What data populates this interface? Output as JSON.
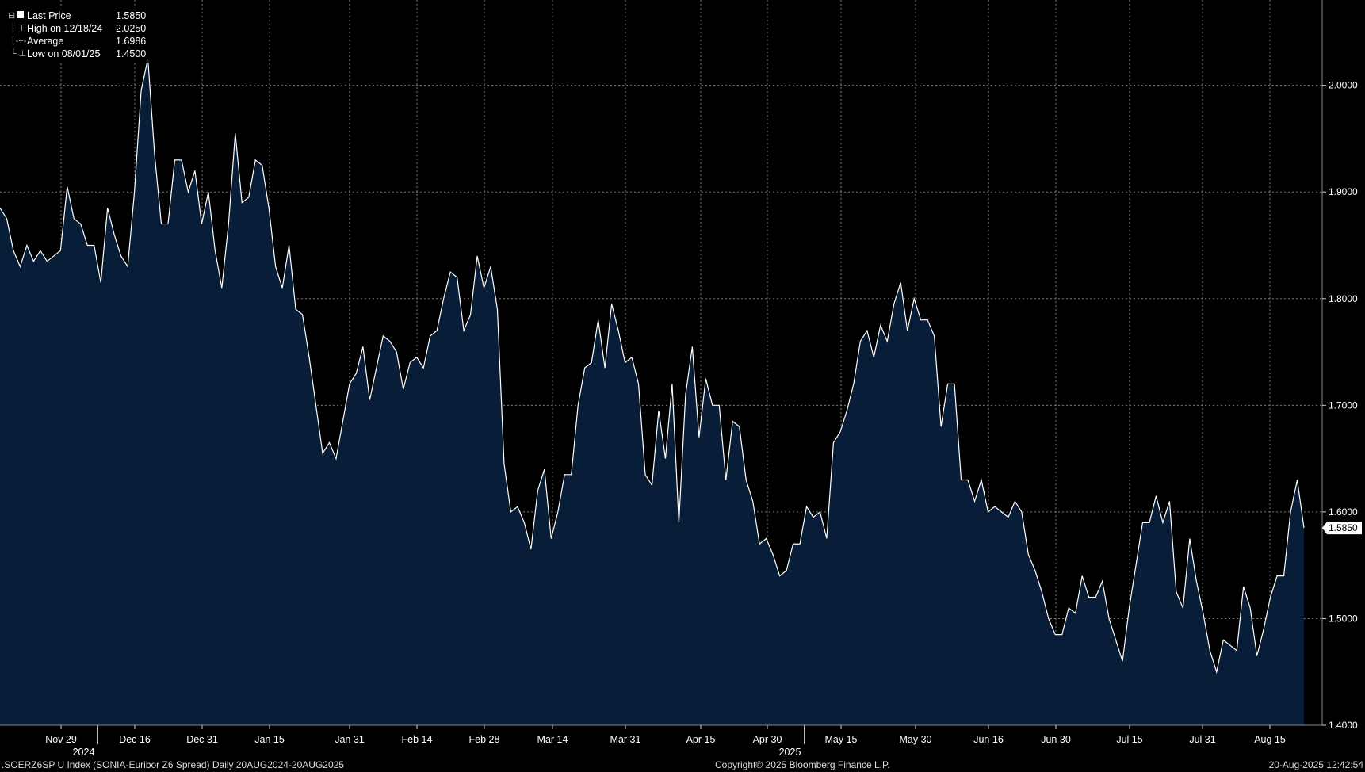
{
  "legend": {
    "items": [
      {
        "label": "Last Price",
        "value": "1.5850"
      },
      {
        "label": "High on 12/18/24",
        "value": "2.0250"
      },
      {
        "label": "Average",
        "value": "1.6986"
      },
      {
        "label": "Low on 08/01/25",
        "value": "1.4500"
      }
    ]
  },
  "footer": {
    "left": ".SOERZ6SP U Index (SONIA-Euribor Z6 Spread)  Daily 20AUG2024-20AUG2025",
    "center": "Copyright© 2025 Bloomberg Finance L.P.",
    "right": "20-Aug-2025 12:42:54"
  },
  "colors": {
    "background": "#000000",
    "area": "#081d38",
    "line": "#ffffff",
    "grid": "#7a7a7a",
    "last_label_bg": "#ffffff"
  },
  "chart_data": {
    "type": "area",
    "ylim": [
      1.4,
      2.08
    ],
    "y_ticks": [
      "1.4000",
      "1.5000",
      "1.6000",
      "1.7000",
      "1.8000",
      "1.9000",
      "2.0000"
    ],
    "x_ticks": [
      "Nov 29",
      "Dec 16",
      "Dec 31",
      "Jan 15",
      "Jan 31",
      "Feb 14",
      "Feb 28",
      "Mar 14",
      "Mar 31",
      "Apr 15",
      "Apr 30",
      "May 15",
      "May 30",
      "Jun 16",
      "Jun 30",
      "Jul 15",
      "Jul 31",
      "Aug 15"
    ],
    "year_labels": [
      {
        "label": "2024",
        "after_tick": "Nov 29"
      },
      {
        "label": "2025",
        "after_tick": "Apr 30"
      }
    ],
    "last_value_label": "1.5850",
    "values": [
      1.885,
      1.875,
      1.845,
      1.83,
      1.85,
      1.835,
      1.845,
      1.835,
      1.84,
      1.845,
      1.905,
      1.875,
      1.87,
      1.85,
      1.85,
      1.815,
      1.885,
      1.86,
      1.84,
      1.83,
      1.9,
      1.995,
      2.025,
      1.935,
      1.87,
      1.87,
      1.93,
      1.93,
      1.9,
      1.92,
      1.87,
      1.9,
      1.845,
      1.81,
      1.87,
      1.955,
      1.89,
      1.895,
      1.93,
      1.925,
      1.885,
      1.83,
      1.81,
      1.85,
      1.79,
      1.785,
      1.745,
      1.7,
      1.655,
      1.665,
      1.65,
      1.685,
      1.72,
      1.73,
      1.755,
      1.705,
      1.735,
      1.765,
      1.76,
      1.75,
      1.715,
      1.74,
      1.745,
      1.735,
      1.765,
      1.77,
      1.8,
      1.825,
      1.82,
      1.77,
      1.785,
      1.84,
      1.81,
      1.83,
      1.79,
      1.645,
      1.6,
      1.605,
      1.59,
      1.565,
      1.62,
      1.64,
      1.575,
      1.6,
      1.635,
      1.635,
      1.7,
      1.735,
      1.74,
      1.78,
      1.735,
      1.795,
      1.77,
      1.74,
      1.745,
      1.72,
      1.635,
      1.625,
      1.695,
      1.65,
      1.72,
      1.59,
      1.71,
      1.755,
      1.67,
      1.725,
      1.7,
      1.7,
      1.63,
      1.685,
      1.68,
      1.63,
      1.61,
      1.57,
      1.575,
      1.56,
      1.54,
      1.545,
      1.57,
      1.57,
      1.605,
      1.595,
      1.6,
      1.575,
      1.665,
      1.675,
      1.695,
      1.72,
      1.76,
      1.77,
      1.745,
      1.775,
      1.76,
      1.795,
      1.815,
      1.77,
      1.8,
      1.78,
      1.78,
      1.765,
      1.68,
      1.72,
      1.72,
      1.63,
      1.63,
      1.61,
      1.63,
      1.6,
      1.605,
      1.6,
      1.595,
      1.61,
      1.6,
      1.56,
      1.545,
      1.525,
      1.5,
      1.485,
      1.485,
      1.51,
      1.505,
      1.54,
      1.52,
      1.52,
      1.535,
      1.5,
      1.48,
      1.46,
      1.51,
      1.55,
      1.59,
      1.59,
      1.615,
      1.59,
      1.61,
      1.525,
      1.51,
      1.575,
      1.535,
      1.505,
      1.47,
      1.45,
      1.48,
      1.475,
      1.47,
      1.53,
      1.51,
      1.465,
      1.49,
      1.52,
      1.54,
      1.54,
      1.6,
      1.63,
      1.585
    ]
  }
}
